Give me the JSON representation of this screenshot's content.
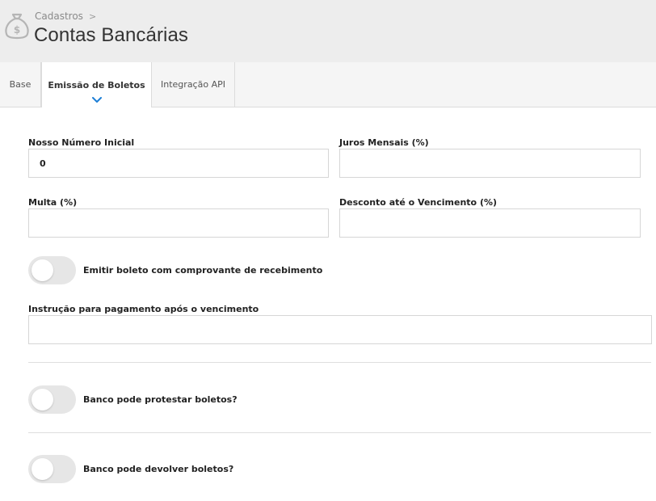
{
  "header": {
    "breadcrumb": "Cadastros",
    "breadcrumb_separator": ">",
    "title": "Contas Bancárias",
    "icon": "money-bag-icon"
  },
  "tabs": [
    {
      "label": "Base",
      "active": false
    },
    {
      "label": "Emissão de Boletos",
      "active": true
    },
    {
      "label": "Integração API",
      "active": false
    }
  ],
  "form": {
    "nosso_numero": {
      "label": "Nosso Número Inicial",
      "value": "0"
    },
    "juros": {
      "label": "Juros Mensais (%)",
      "value": ""
    },
    "multa": {
      "label": "Multa (%)",
      "value": ""
    },
    "desconto": {
      "label": "Desconto até o Vencimento (%)",
      "value": ""
    },
    "emitir_comprovante": {
      "label": "Emitir boleto com comprovante de recebimento",
      "checked": false
    },
    "instrucao": {
      "label": "Instrução para pagamento após o vencimento",
      "value": ""
    },
    "protestar": {
      "label": "Banco pode protestar boletos?",
      "checked": false
    },
    "devolver": {
      "label": "Banco pode devolver boletos?",
      "checked": false
    }
  },
  "colors": {
    "accent": "#1e7fd6",
    "header_bg": "#ededed",
    "toggle_off": "#e6e6e6"
  }
}
